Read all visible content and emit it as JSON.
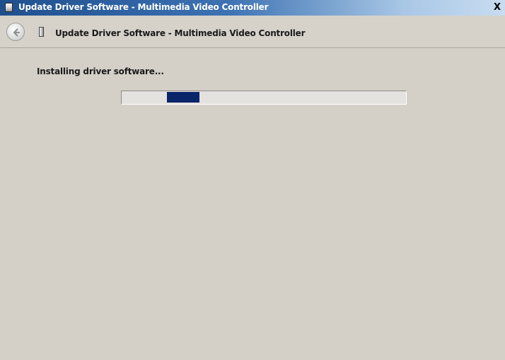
{
  "window": {
    "title": "Update Driver Software - Multimedia Video Controller",
    "close_label": "X"
  },
  "header": {
    "back_icon": "back-arrow-icon",
    "device_icon": "device-icon",
    "title": "Update Driver Software - Multimedia Video Controller"
  },
  "main": {
    "status": "Installing driver software...",
    "progress": {
      "style": "marquee",
      "indeterminate": true
    }
  },
  "colors": {
    "title_bar_start": "#1f4f8e",
    "title_bar_end": "#c8dcf0",
    "window_background": "#d4d0c8",
    "progress_fill": "#0a246a"
  }
}
